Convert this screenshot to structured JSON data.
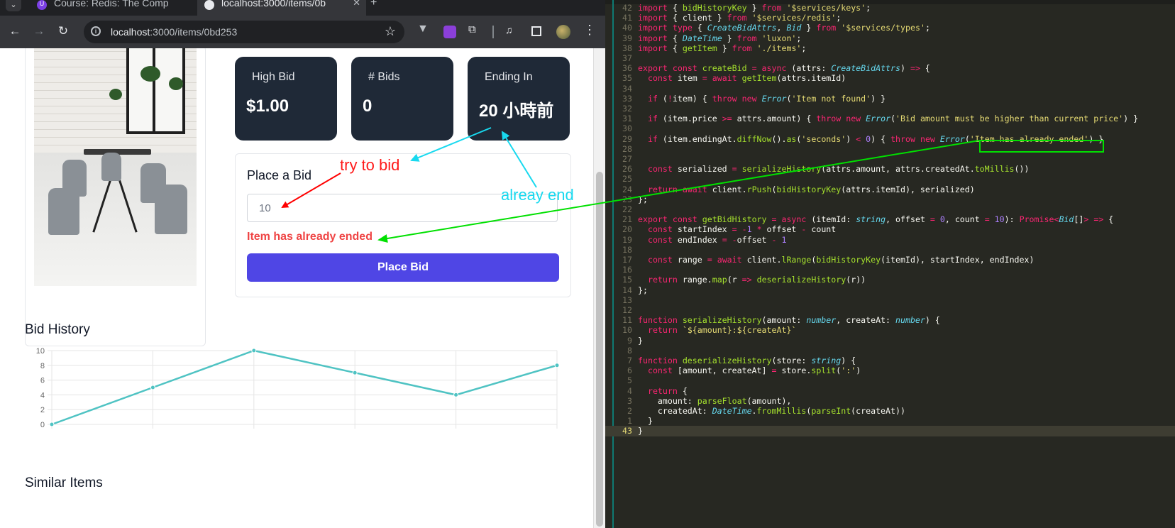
{
  "browser": {
    "tabs": [
      {
        "label": "Course: Redis: The Comp",
        "active": false
      },
      {
        "label": "localhost:3000/items/0b",
        "active": true
      }
    ],
    "url_host": "localhost",
    "url_path": ":3000/items/0bd253"
  },
  "stats": [
    {
      "label": "High Bid",
      "value": "$1.00"
    },
    {
      "label": "# Bids",
      "value": "0"
    },
    {
      "label": "Ending In",
      "value": "20 小時前"
    }
  ],
  "bid_form": {
    "title": "Place a Bid",
    "input_value": "10",
    "error": "Item has already ended",
    "button_label": "Place Bid"
  },
  "bid_history_title": "Bid History",
  "similar_title": "Similar Items",
  "chart_data": {
    "type": "line",
    "x": [
      0,
      1,
      2,
      3,
      4,
      5
    ],
    "values": [
      0,
      5,
      10,
      7,
      4,
      8
    ],
    "y_ticks": [
      "0",
      "2",
      "4",
      "6",
      "8",
      "10"
    ],
    "ylim": [
      0,
      10
    ],
    "grid": true,
    "color": "#4fc3c3"
  },
  "annotations": {
    "try": "try to bid",
    "ended": "alreay end"
  },
  "colors": {
    "red_arrow": "#ff0000",
    "cyan_arrow": "#00e5ff",
    "green_arrow": "#00e000"
  },
  "editor": {
    "lines": [
      {
        "n": "42",
        "t": "import { bidHistoryKey } from '$services/keys';"
      },
      {
        "n": "41",
        "t": "import { client } from '$services/redis';"
      },
      {
        "n": "40",
        "t": "import type { CreateBidAttrs, Bid } from '$services/types';"
      },
      {
        "n": "39",
        "t": "import { DateTime } from 'luxon';"
      },
      {
        "n": "38",
        "t": "import { getItem } from './items';"
      },
      {
        "n": "37",
        "t": ""
      },
      {
        "n": "36",
        "t": "export const createBid = async (attrs: CreateBidAttrs) => {"
      },
      {
        "n": "35",
        "t": "  const item = await getItem(attrs.itemId)"
      },
      {
        "n": "34",
        "t": ""
      },
      {
        "n": "33",
        "t": "  if (!item) { throw new Error('Item not found') }"
      },
      {
        "n": "32",
        "t": ""
      },
      {
        "n": "31",
        "t": "  if (item.price >= attrs.amount) { throw new Error('Bid amount must be higher than current price') }"
      },
      {
        "n": "30",
        "t": ""
      },
      {
        "n": "29",
        "t": "  if (item.endingAt.diffNow().as('seconds') < 0) { throw new Error('Item has already ended') }"
      },
      {
        "n": "28",
        "t": ""
      },
      {
        "n": "27",
        "t": ""
      },
      {
        "n": "26",
        "t": "  const serialized = serializeHistory(attrs.amount, attrs.createdAt.toMillis())"
      },
      {
        "n": "25",
        "t": ""
      },
      {
        "n": "24",
        "t": "  return await client.rPush(bidHistoryKey(attrs.itemId), serialized)"
      },
      {
        "n": "23",
        "t": "};"
      },
      {
        "n": "22",
        "t": ""
      },
      {
        "n": "21",
        "t": "export const getBidHistory = async (itemId: string, offset = 0, count = 10): Promise<Bid[]> => {"
      },
      {
        "n": "20",
        "t": "  const startIndex = -1 * offset - count"
      },
      {
        "n": "19",
        "t": "  const endIndex = -offset - 1"
      },
      {
        "n": "18",
        "t": ""
      },
      {
        "n": "17",
        "t": "  const range = await client.lRange(bidHistoryKey(itemId), startIndex, endIndex)"
      },
      {
        "n": "16",
        "t": ""
      },
      {
        "n": "15",
        "t": "  return range.map(r => deserializeHistory(r))"
      },
      {
        "n": "14",
        "t": "};"
      },
      {
        "n": "13",
        "t": ""
      },
      {
        "n": "12",
        "t": ""
      },
      {
        "n": "11",
        "t": "function serializeHistory(amount: number, createAt: number) {"
      },
      {
        "n": "10",
        "t": "  return `${amount}:${createAt}`"
      },
      {
        "n": "9",
        "t": "}"
      },
      {
        "n": "8",
        "t": ""
      },
      {
        "n": "7",
        "t": "function deserializeHistory(store: string) {"
      },
      {
        "n": "6",
        "t": "  const [amount, createAt] = store.split(':')"
      },
      {
        "n": "5",
        "t": ""
      },
      {
        "n": "4",
        "t": "  return {"
      },
      {
        "n": "3",
        "t": "    amount: parseFloat(amount),"
      },
      {
        "n": "2",
        "t": "    createdAt: DateTime.fromMillis(parseInt(createAt))"
      },
      {
        "n": "1",
        "t": "  }"
      },
      {
        "n": "43",
        "t": "}",
        "current": true
      }
    ]
  }
}
